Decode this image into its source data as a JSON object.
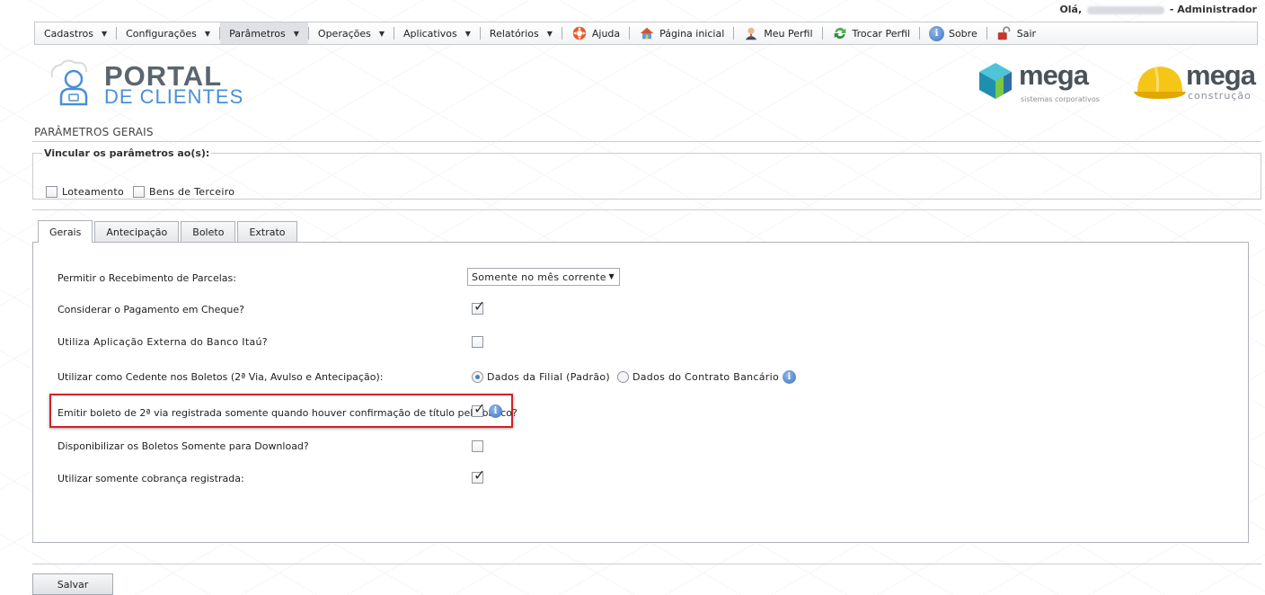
{
  "header": {
    "greeting_prefix": "Olá,",
    "greeting_suffix": "- Administrador"
  },
  "menu": {
    "items": [
      {
        "label": "Cadastros",
        "has_caret": true
      },
      {
        "label": "Configurações",
        "has_caret": true
      },
      {
        "label": "Parâmetros",
        "has_caret": true,
        "active": true
      },
      {
        "label": "Operações",
        "has_caret": true
      },
      {
        "label": "Aplicativos",
        "has_caret": true
      },
      {
        "label": "Relatórios",
        "has_caret": true
      },
      {
        "label": "Ajuda",
        "icon": "lifebuoy-icon"
      },
      {
        "label": "Página inicial",
        "icon": "home-icon"
      },
      {
        "label": "Meu Perfil",
        "icon": "user-profile-icon"
      },
      {
        "label": "Trocar Perfil",
        "icon": "refresh-icon"
      },
      {
        "label": "Sobre",
        "icon": "info-icon"
      },
      {
        "label": "Sair",
        "icon": "unlock-icon"
      }
    ]
  },
  "logos": {
    "portal_line1": "PORTAL",
    "portal_line2": "DE CLIENTES",
    "mega1_word": "mega",
    "mega1_sub": "sistemas corporativos",
    "mega2_word": "mega",
    "mega2_sub": "construção"
  },
  "page": {
    "title": "PARÂMETROS GERAIS"
  },
  "vincular": {
    "legend": "Vincular os parâmetros ao(s):",
    "options": [
      {
        "label": "Loteamento",
        "checked": false
      },
      {
        "label": "Bens de Terceiro",
        "checked": false
      }
    ]
  },
  "tabs": [
    {
      "label": "Gerais",
      "active": true
    },
    {
      "label": "Antecipação"
    },
    {
      "label": "Boleto"
    },
    {
      "label": "Extrato"
    }
  ],
  "form": {
    "permitir_label": "Permitir o Recebimento de Parcelas:",
    "permitir_value": "Somente no mês corrente",
    "cheque_label": "Considerar o Pagamento em Cheque?",
    "cheque_checked": true,
    "itau_label": "Utiliza Aplicação Externa do Banco Itaú?",
    "itau_checked": false,
    "cedente_label": "Utilizar como Cedente nos Boletos (2ª Via, Avulso e Antecipação):",
    "cedente_option1": "Dados da Filial (Padrão)",
    "cedente_option2": "Dados do Contrato Bancário",
    "cedente_selected": "Dados da Filial (Padrão)",
    "emitir_label": "Emitir boleto de 2ª via registrada somente quando houver confirmação de título pelo banco?",
    "emitir_checked": true,
    "download_label": "Disponibilizar os Boletos Somente para Download?",
    "download_checked": false,
    "cobranca_label": "Utilizar somente cobrança registrada:",
    "cobranca_checked": true
  },
  "actions": {
    "save_label": "Salvar"
  },
  "colors": {
    "highlight": "#d3202a",
    "accent_blue": "#4a8fd6"
  }
}
